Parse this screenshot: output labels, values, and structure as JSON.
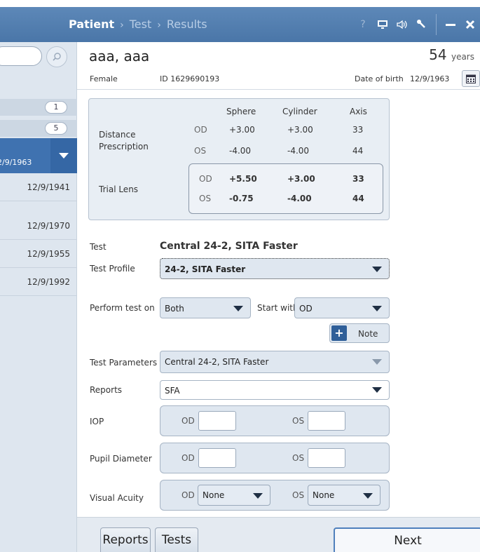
{
  "breadcrumb": {
    "current": "Patient",
    "steps": [
      "Test",
      "Results"
    ]
  },
  "sidebar": {
    "groups": [
      {
        "count": "1"
      },
      {
        "count": "5"
      }
    ],
    "selected_date": "2/9/1963",
    "items": [
      "12/9/1941",
      "12/9/1970",
      "12/9/1955",
      "12/9/1992"
    ]
  },
  "patient": {
    "name": "aaa, aaa",
    "age": "54",
    "age_unit": "years",
    "sex": "Female",
    "id_label": "ID",
    "id": "1629690193",
    "dob_label": "Date of birth",
    "dob": "12/9/1963"
  },
  "prescription": {
    "headers": [
      "Sphere",
      "Cylinder",
      "Axis"
    ],
    "distance_label_1": "Distance",
    "distance_label_2": "Prescription",
    "distance": {
      "od": {
        "eye": "OD",
        "sphere": "+3.00",
        "cylinder": "+3.00",
        "axis": "33"
      },
      "os": {
        "eye": "OS",
        "sphere": "-4.00",
        "cylinder": "-4.00",
        "axis": "44"
      }
    },
    "trial_label": "Trial Lens",
    "trial": {
      "od": {
        "eye": "OD",
        "sphere": "+5.50",
        "cylinder": "+3.00",
        "axis": "33"
      },
      "os": {
        "eye": "OS",
        "sphere": "-0.75",
        "cylinder": "-4.00",
        "axis": "44"
      }
    }
  },
  "form": {
    "test_label": "Test",
    "test_value": "Central 24-2, SITA Faster",
    "profile_label": "Test Profile",
    "profile_value": "24-2, SITA Faster",
    "perform_label": "Perform test on",
    "perform_value": "Both",
    "start_with_label": "Start with",
    "start_with_value": "OD",
    "note_label": "Note",
    "params_label": "Test Parameters",
    "params_value": "Central 24-2, SITA Faster",
    "reports_label": "Reports",
    "reports_value": "SFA",
    "iop_label": "IOP",
    "pupil_label": "Pupil Diameter",
    "va_label": "Visual Acuity",
    "od": "OD",
    "os": "OS",
    "va_od_value": "None",
    "va_os_value": "None"
  },
  "footer": {
    "reports": "Reports",
    "tests": "Tests",
    "next": "Next"
  }
}
